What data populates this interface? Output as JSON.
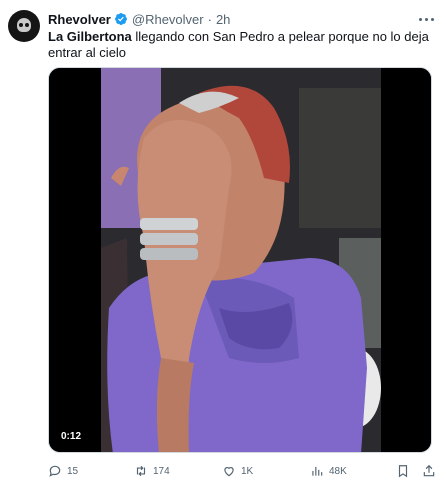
{
  "author": {
    "display_name": "Rhevolver",
    "handle": "@Rhevolver",
    "separator": "·",
    "time": "2h",
    "verified_color": "#1d9bf0"
  },
  "tweet": {
    "text_bold": "La Gilbertona",
    "text_rest": " llegando con San Pedro a pelear porque no lo deja entrar al cielo"
  },
  "media": {
    "duration": "0:12"
  },
  "actions": {
    "replies": "15",
    "retweets": "174",
    "likes": "1K",
    "views": "48K"
  },
  "colors": {
    "secondary_text": "#536471",
    "primary_text": "#0f1419"
  }
}
